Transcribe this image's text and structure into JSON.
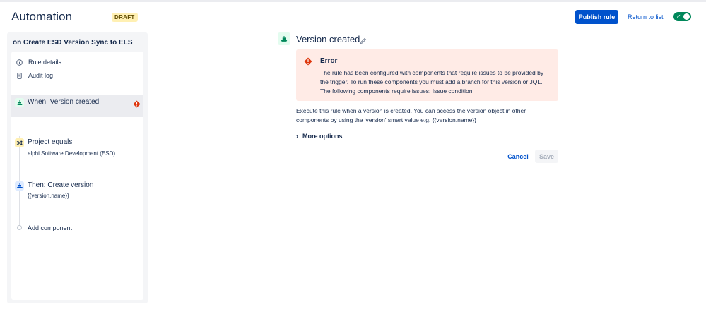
{
  "header": {
    "title": "Automation",
    "status_badge": "DRAFT",
    "publish_label": "Publish rule",
    "return_label": "Return to list",
    "toggle_check": "✓",
    "toggle_enabled": true
  },
  "sidebar": {
    "rule_name": "on Create ESD Version Sync to ELS",
    "nav": [
      {
        "label": "Rule details",
        "icon": "info-icon"
      },
      {
        "label": "Audit log",
        "icon": "document-icon"
      }
    ],
    "components": [
      {
        "title": "When: Version created",
        "subtitle": "",
        "icon": "ship-icon",
        "selected": true,
        "has_error": true
      },
      {
        "title": "Project equals",
        "subtitle": "elphi Software Development (ESD)",
        "icon": "shuffle-icon",
        "selected": false,
        "has_error": false
      },
      {
        "title": "Then: Create version",
        "subtitle": "{{version.name}}",
        "icon": "ship-icon",
        "selected": false,
        "has_error": false
      }
    ],
    "add_component_label": "Add component"
  },
  "panel": {
    "title": "Version created",
    "error": {
      "heading": "Error",
      "message": "The rule has been configured with components that require issues to be provided by the trigger. To run these components you must add a branch for this version or JQL. The following components require issues: Issue condition"
    },
    "description": "Execute this rule when a version is created. You can access the version object in other components by using the 'version' smart value e.g. {{version.name}}",
    "more_options_label": "More options",
    "cancel_label": "Cancel",
    "save_label": "Save"
  },
  "colors": {
    "primary": "#0052CC",
    "success": "#00875A",
    "error": "#DE350B",
    "error_bg": "#FFEBE6",
    "draft_bg": "#FFF0B3"
  }
}
